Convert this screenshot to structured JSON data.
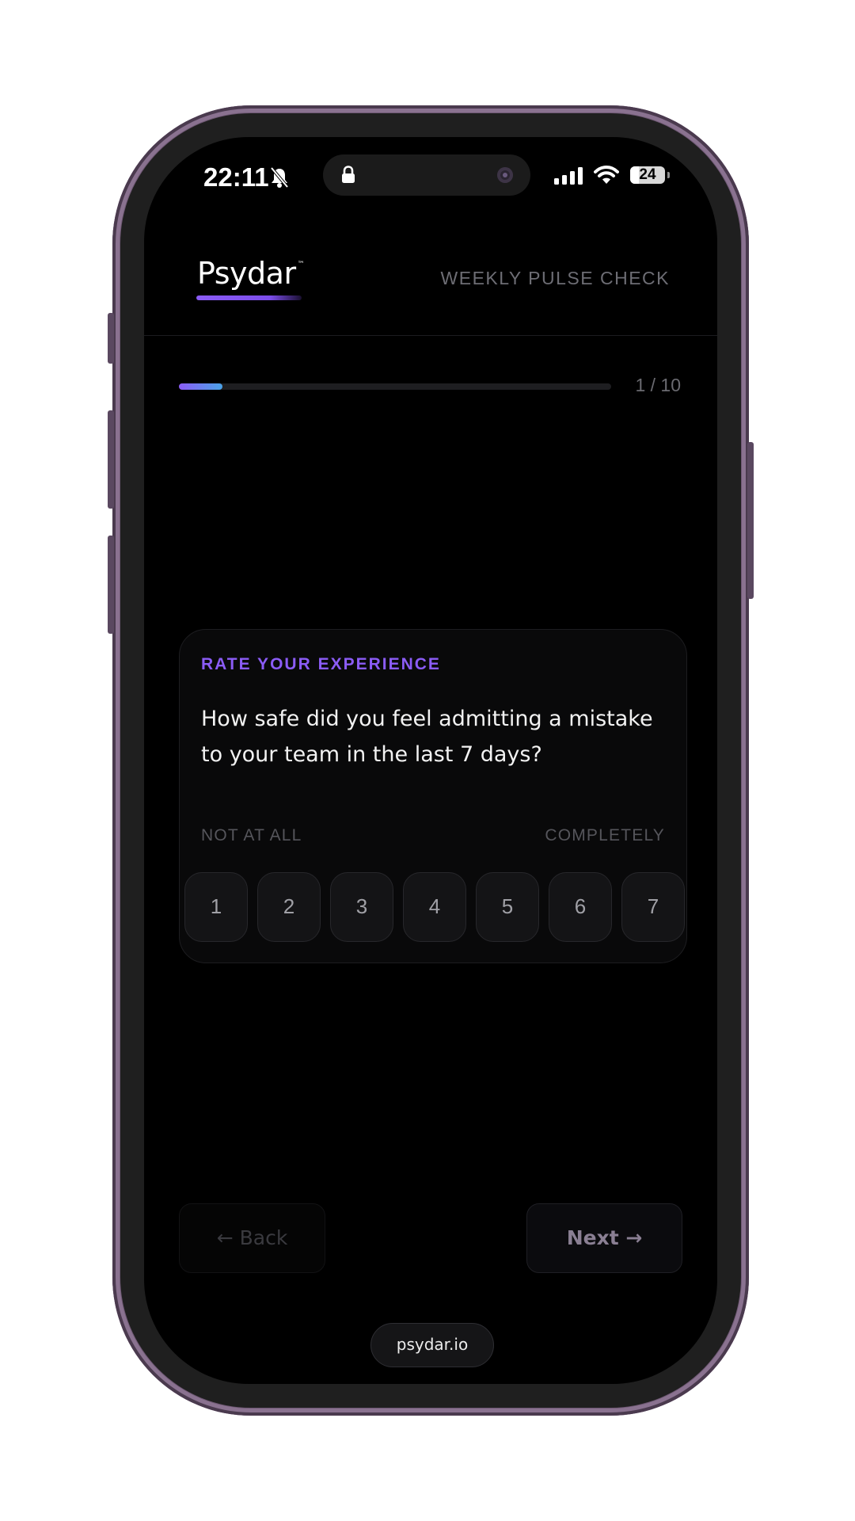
{
  "status_bar": {
    "time": "22:11",
    "battery_level": "24",
    "battery_fraction": 0.24,
    "icons": [
      "bell-slash-icon",
      "lock-icon",
      "signal-icon",
      "wifi-icon",
      "battery-icon"
    ]
  },
  "header": {
    "logo": "Psydar",
    "logo_tm": "™",
    "subtitle": "WEEKLY PULSE CHECK"
  },
  "progress": {
    "current": 1,
    "total": 10,
    "label": "1 / 10",
    "fraction": 0.1
  },
  "question_card": {
    "eyebrow": "RATE YOUR EXPERIENCE",
    "question": "How safe did you feel admitting a mistake to your team in the last 7 days?",
    "scale_min_label": "NOT AT ALL",
    "scale_max_label": "COMPLETELY",
    "options": [
      "1",
      "2",
      "3",
      "4",
      "5",
      "6",
      "7"
    ]
  },
  "navigation": {
    "back_label": "← Back",
    "next_label": "Next →"
  },
  "footer": {
    "site": "psydar.io"
  },
  "colors": {
    "accent": "#8b5cf6",
    "progress_end": "#4aa3e8",
    "background": "#000000",
    "frame": "#6e5873"
  }
}
